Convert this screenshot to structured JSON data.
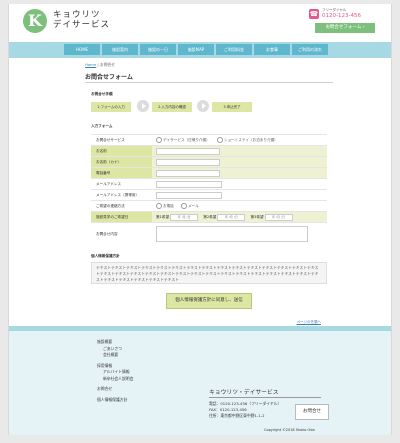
{
  "header": {
    "logo_mark": "K",
    "logo_line1": "キョウリツ",
    "logo_line2": "デイサービス",
    "tel_label": "フリーダイヤル",
    "tel_number": "0120-123-456",
    "contact_button": "お問合せフォーム ›"
  },
  "nav": [
    "HOME",
    "施設案内",
    "施設の一日",
    "施設MAP",
    "ご利用料金",
    "お食事",
    "ご利用の流れ"
  ],
  "breadcrumb": {
    "home": "Home",
    "separator": " | ",
    "current": "お問合せ"
  },
  "page_title": "お問合せフォーム",
  "steps_heading": "お問合せ手順",
  "steps": [
    "1.フォームの入力",
    "2.入力内容の確認",
    "3.申込完了"
  ],
  "form_heading": "入力フォーム",
  "form": {
    "service_label": "お問合せサービス",
    "service_options": [
      "デイサービス（日帰り介護）",
      "ショートステイ（お泊まり介護）"
    ],
    "name_label": "お名前",
    "kana_label": "お名前（カナ）",
    "tel_label": "電話番号",
    "email_label": "メールアドレス",
    "mobile_email_label": "メールアドレス（携帯用）",
    "contact_method_label": "ご希望の連絡方法",
    "contact_methods": [
      "お電話",
      "メール"
    ],
    "visit_label": "施設見学のご希望日",
    "visit_choices": [
      "第1希望",
      "第2希望",
      "第3希望"
    ],
    "date_placeholder": "年 /月 /日",
    "message_label": "お問合せ内容"
  },
  "privacy_heading": "個人情報保護方針",
  "privacy_text": "テキストテキストテキストテキストテキストテキストテキストテキストテキストテキストテキストテキストテキストテキストテキストテキストテキストテキストテキストテキストテキストテキストテキストテキストテキストテキストテキストテキストテキストテキストテキストテキストテキストテキストテキスト",
  "agree_button": "個人情報保護方針に同意し、送信",
  "page_top": "ページの先頭へ",
  "footer": {
    "links": [
      {
        "label": "施設概要",
        "sub": [
          "ごあいさつ",
          "会社概要"
        ]
      },
      {
        "label": "採用情報",
        "sub": [
          "アルバイト情報",
          "新卒社会人説明会"
        ]
      },
      {
        "label": "お問合せ",
        "sub": []
      },
      {
        "label": "個人情報保護方針",
        "sub": []
      }
    ],
    "company": "キョウリツ・デイサービス",
    "tel": "電話：0120-123-456（フリーダイヤル）",
    "fax": "FAX：0120-123-456",
    "address": "住所：東京都中野区東中野1-1-2",
    "contact_button": "お問合せ",
    "copyright": "Copyright ©2018 Shoko Oda"
  },
  "colors": {
    "brand_green": "#7dc07e",
    "nav_blue": "#5fb7cd",
    "light_blue": "#a6d9e4",
    "required_green": "#dde6a3",
    "tel_pink": "#e8578b"
  }
}
